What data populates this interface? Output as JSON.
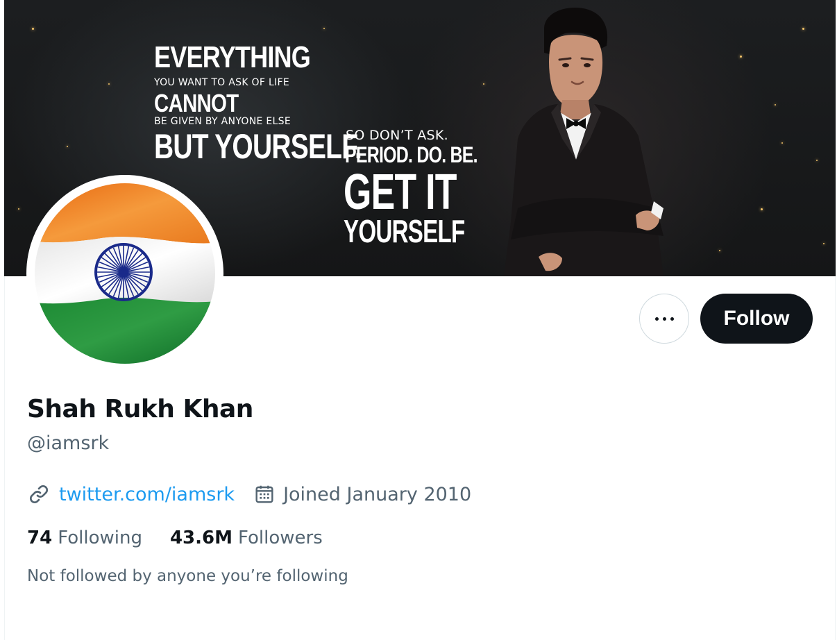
{
  "banner": {
    "quote_left": {
      "line1": "EVERYTHING",
      "line2": "YOU WANT TO ASK OF LIFE",
      "line3": "CANNOT",
      "line4": "BE GIVEN BY ANYONE ELSE",
      "line5": "BUT YOURSELF."
    },
    "quote_right": {
      "line1": "SO DON’T ASK.",
      "line2": "PERIOD. DO. BE.",
      "line3": "GET IT",
      "line4": "YOURSELF"
    }
  },
  "avatar": {
    "icon": "india-flag"
  },
  "actions": {
    "more_icon": "more-horizontal-icon",
    "follow_label": "Follow"
  },
  "profile": {
    "display_name": "Shah Rukh Khan",
    "handle": "@iamsrk",
    "website": "twitter.com/iamsrk",
    "joined": "Joined January 2010",
    "link_icon": "link-icon",
    "calendar_icon": "calendar-icon"
  },
  "stats": {
    "following_count": "74",
    "following_label": "Following",
    "followers_count": "43.6M",
    "followers_label": "Followers"
  },
  "social_context": "Not followed by anyone you’re following",
  "colors": {
    "text_primary": "#0f1419",
    "text_secondary": "#536471",
    "link": "#1d9bf0",
    "button_dark": "#0f1419",
    "saffron": "#f47b20",
    "green": "#138a36",
    "chakra": "#1a2a8a"
  }
}
